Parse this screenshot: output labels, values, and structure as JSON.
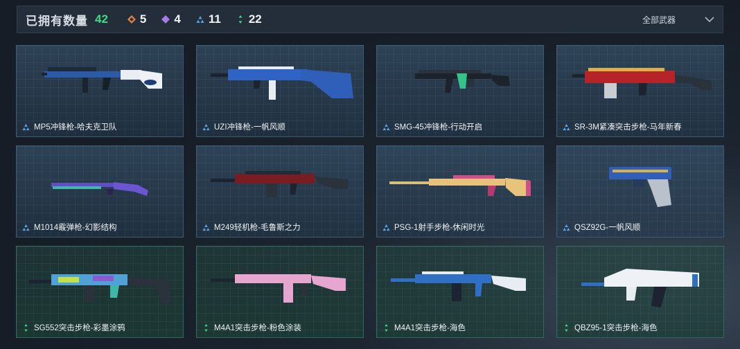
{
  "header": {
    "title": "已拥有数量",
    "total": "42",
    "stats": [
      {
        "icon": "orange-diamond-icon",
        "color": "#e8833a",
        "count": "5"
      },
      {
        "icon": "purple-diamond-icon",
        "color": "#a77bea",
        "count": "4"
      },
      {
        "icon": "blue-triangle-icon",
        "color": "#5aa3e6",
        "count": "11"
      },
      {
        "icon": "green-dots-icon",
        "color": "#3ddc84",
        "count": "22"
      }
    ],
    "filter": {
      "label": "全部武器",
      "icon": "chevron-down-icon"
    }
  },
  "items": [
    {
      "name": "MP5冲锋枪-哈夫克卫队",
      "rarity": "blue"
    },
    {
      "name": "UZI冲锋枪-一帆风顺",
      "rarity": "blue"
    },
    {
      "name": "SMG-45冲锋枪-行动开启",
      "rarity": "blue"
    },
    {
      "name": "SR-3M紧凑突击步枪-马年新春",
      "rarity": "blue"
    },
    {
      "name": "M1014霰弹枪-幻影结构",
      "rarity": "blue"
    },
    {
      "name": "M249轻机枪-毛鲁斯之力",
      "rarity": "blue"
    },
    {
      "name": "PSG-1射手步枪-休闲时光",
      "rarity": "blue"
    },
    {
      "name": "QSZ92G-一帆风顺",
      "rarity": "blue"
    },
    {
      "name": "SG552突击步枪-彩墨涂鸦",
      "rarity": "green"
    },
    {
      "name": "M4A1突击步枪-粉色涂装",
      "rarity": "green"
    },
    {
      "name": "M4A1突击步枪-海色",
      "rarity": "green"
    },
    {
      "name": "QBZ95-1突击步枪-海色",
      "rarity": "green"
    }
  ]
}
